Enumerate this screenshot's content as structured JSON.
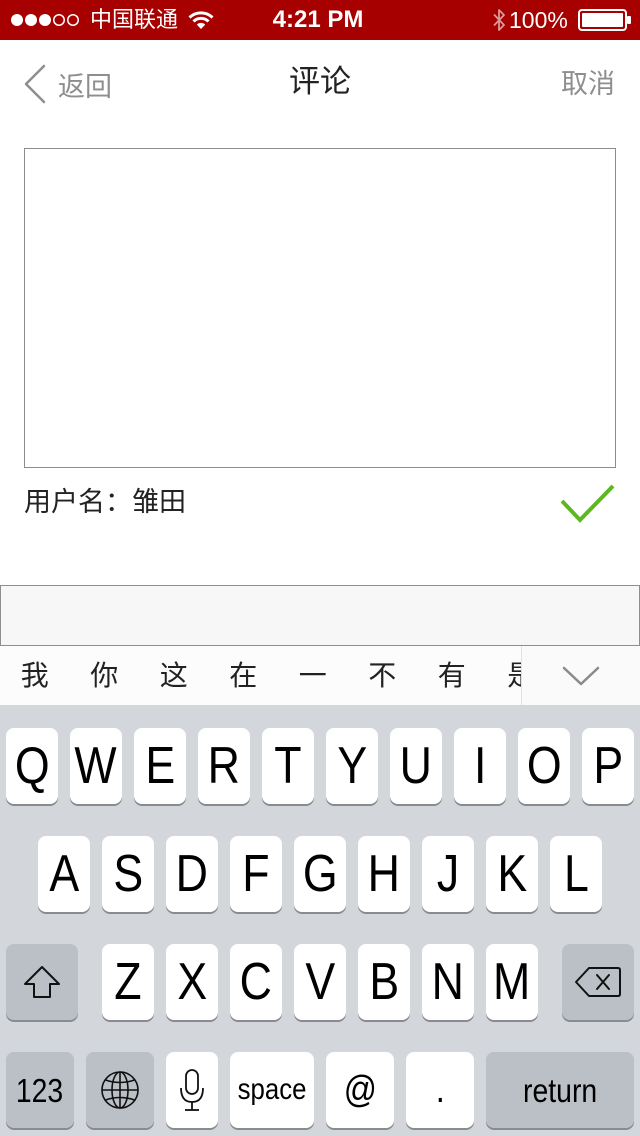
{
  "status_bar": {
    "signal": {
      "strength": 3,
      "max": 5
    },
    "carrier": "中国联通",
    "time": "4:21 PM",
    "battery_text": "100%",
    "battery_level": 1.0,
    "icons": [
      "signal-icon",
      "wifi-icon",
      "bluetooth-icon",
      "battery-icon"
    ]
  },
  "nav": {
    "back_label": "返回",
    "title": "评论",
    "cancel_label": "取消",
    "back_icon": "chevron-left-icon"
  },
  "comment": {
    "text": "",
    "user_label": "用户名：雏田",
    "submit_icon": "checkmark-icon"
  },
  "ime": {
    "candidates": [
      "我",
      "你",
      "这",
      "在",
      "一",
      "不",
      "有",
      "是"
    ],
    "collapse_icon": "chevron-down-icon"
  },
  "keyboard": {
    "row1": [
      "Q",
      "W",
      "E",
      "R",
      "T",
      "Y",
      "U",
      "I",
      "O",
      "P"
    ],
    "row2": [
      "A",
      "S",
      "D",
      "F",
      "G",
      "H",
      "J",
      "K",
      "L"
    ],
    "row3": [
      "Z",
      "X",
      "C",
      "V",
      "B",
      "N",
      "M"
    ],
    "numbers_label": "123",
    "space_label": "space",
    "at_label": "@",
    "period_label": ".",
    "return_label": "return",
    "icons": [
      "shift-icon",
      "delete-icon",
      "globe-icon",
      "mic-icon"
    ]
  },
  "colors": {
    "status_bar": "#a60000",
    "accent_green": "#5cb81e",
    "keyboard_bg": "#d3d6db",
    "special_key_bg": "#bbc0c6"
  }
}
